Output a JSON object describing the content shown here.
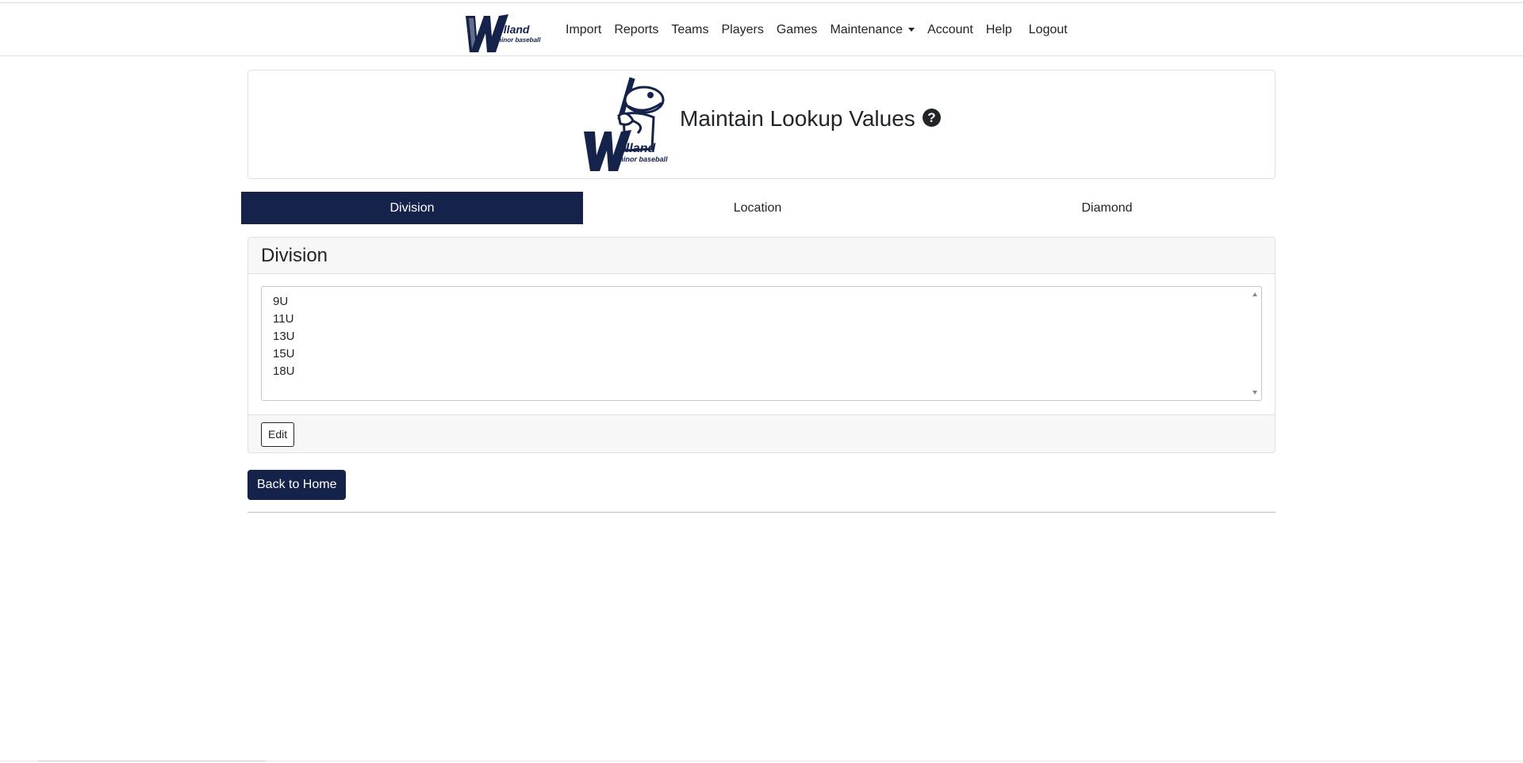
{
  "brand": {
    "logo_name": "welland-minor-baseball-logo",
    "logo_word": "elland",
    "logo_sub": "minor baseball"
  },
  "nav": {
    "items": [
      {
        "label": "Import"
      },
      {
        "label": "Reports"
      },
      {
        "label": "Teams"
      },
      {
        "label": "Players"
      },
      {
        "label": "Games"
      },
      {
        "label": "Maintenance"
      },
      {
        "label": "Account"
      },
      {
        "label": "Help"
      },
      {
        "label": "Logout"
      }
    ]
  },
  "header": {
    "title": "Maintain Lookup Values",
    "help_icon": "?"
  },
  "tabs": [
    {
      "label": "Division",
      "active": true
    },
    {
      "label": "Location",
      "active": false
    },
    {
      "label": "Diamond",
      "active": false
    }
  ],
  "panel": {
    "title": "Division",
    "items": [
      "9U",
      "11U",
      "13U",
      "15U",
      "18U"
    ],
    "edit_label": "Edit"
  },
  "back_home_label": "Back to Home",
  "colors": {
    "brand_navy": "#15234b",
    "border": "#dee2e6",
    "panel_bg": "#f7f7f7"
  }
}
